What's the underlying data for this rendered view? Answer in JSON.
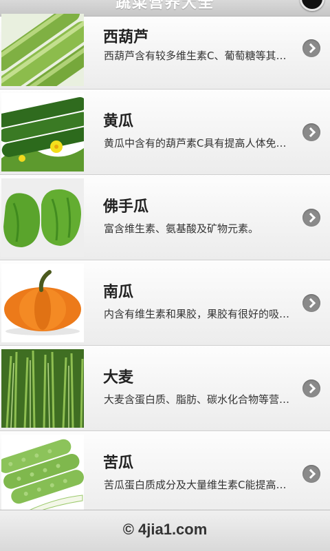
{
  "header": {
    "title": "蔬菜营养大全"
  },
  "items": [
    {
      "title": "西葫芦",
      "desc": "西葫芦含有较多维生素C、葡萄糖等其他营养物质",
      "thumb_icon": "zucchini-image"
    },
    {
      "title": "黄瓜",
      "desc": "黄瓜中含有的葫芦素C具有提高人体免疫功能",
      "thumb_icon": "cucumber-image"
    },
    {
      "title": "佛手瓜",
      "desc": "富含维生素、氨基酸及矿物元素。",
      "thumb_icon": "chayote-image"
    },
    {
      "title": "南瓜",
      "desc": "内含有维生素和果胶，果胶有很好的吸附性",
      "thumb_icon": "pumpkin-image"
    },
    {
      "title": "大麦",
      "desc": "大麦含蛋白质、脂肪、碳水化合物等营养成分",
      "thumb_icon": "barley-image"
    },
    {
      "title": "苦瓜",
      "desc": "苦瓜蛋白质成分及大量维生素C能提高免疫力",
      "thumb_icon": "bitter-melon-image"
    }
  ],
  "footer": {
    "copyright": "© 4jia1.com"
  }
}
